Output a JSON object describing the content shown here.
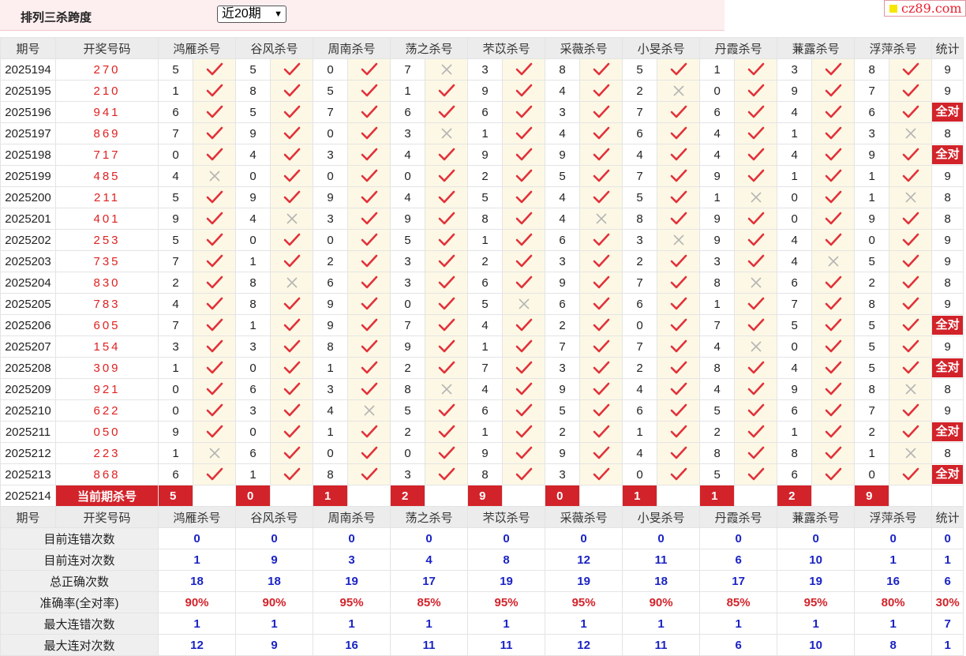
{
  "header": {
    "title": "排列三杀跨度",
    "range_select": "近20期",
    "site_logo": "cz89.com"
  },
  "colors": {
    "accent_red": "#d2232a",
    "draw_red": "#e02020",
    "stat_blue": "#1a23c4",
    "mark_bg": "#fcf8e5"
  },
  "columns": {
    "period": "期号",
    "draw": "开奖号码",
    "count": "统计",
    "experts": [
      "鸿雁杀号",
      "谷风杀号",
      "周南杀号",
      "荡之杀号",
      "芣苡杀号",
      "采薇杀号",
      "小旻杀号",
      "丹霞杀号",
      "蒹露杀号",
      "浮萍杀号"
    ]
  },
  "labels": {
    "all_correct": "全对",
    "current_kill": "当前期杀号"
  },
  "rows": [
    {
      "period": "2025194",
      "draw": "270",
      "k": [
        5,
        5,
        0,
        7,
        3,
        8,
        5,
        1,
        3,
        8
      ],
      "ok": [
        1,
        1,
        1,
        0,
        1,
        1,
        1,
        1,
        1,
        1
      ],
      "count": "9"
    },
    {
      "period": "2025195",
      "draw": "210",
      "k": [
        1,
        8,
        5,
        1,
        9,
        4,
        2,
        0,
        9,
        7
      ],
      "ok": [
        1,
        1,
        1,
        1,
        1,
        1,
        0,
        1,
        1,
        1
      ],
      "count": "9"
    },
    {
      "period": "2025196",
      "draw": "941",
      "k": [
        6,
        5,
        7,
        6,
        6,
        3,
        7,
        6,
        4,
        6
      ],
      "ok": [
        1,
        1,
        1,
        1,
        1,
        1,
        1,
        1,
        1,
        1
      ],
      "count": "全对"
    },
    {
      "period": "2025197",
      "draw": "869",
      "k": [
        7,
        9,
        0,
        3,
        1,
        4,
        6,
        4,
        1,
        3
      ],
      "ok": [
        1,
        1,
        1,
        0,
        1,
        1,
        1,
        1,
        1,
        0
      ],
      "count": "8"
    },
    {
      "period": "2025198",
      "draw": "717",
      "k": [
        0,
        4,
        3,
        4,
        9,
        9,
        4,
        4,
        4,
        9
      ],
      "ok": [
        1,
        1,
        1,
        1,
        1,
        1,
        1,
        1,
        1,
        1
      ],
      "count": "全对"
    },
    {
      "period": "2025199",
      "draw": "485",
      "k": [
        4,
        0,
        0,
        0,
        2,
        5,
        7,
        9,
        1,
        1
      ],
      "ok": [
        0,
        1,
        1,
        1,
        1,
        1,
        1,
        1,
        1,
        1
      ],
      "count": "9"
    },
    {
      "period": "2025200",
      "draw": "211",
      "k": [
        5,
        9,
        9,
        4,
        5,
        4,
        5,
        1,
        0,
        1
      ],
      "ok": [
        1,
        1,
        1,
        1,
        1,
        1,
        1,
        0,
        1,
        0
      ],
      "count": "8"
    },
    {
      "period": "2025201",
      "draw": "401",
      "k": [
        9,
        4,
        3,
        9,
        8,
        4,
        8,
        9,
        0,
        9
      ],
      "ok": [
        1,
        0,
        1,
        1,
        1,
        0,
        1,
        1,
        1,
        1
      ],
      "count": "8"
    },
    {
      "period": "2025202",
      "draw": "253",
      "k": [
        5,
        0,
        0,
        5,
        1,
        6,
        3,
        9,
        4,
        0
      ],
      "ok": [
        1,
        1,
        1,
        1,
        1,
        1,
        0,
        1,
        1,
        1
      ],
      "count": "9"
    },
    {
      "period": "2025203",
      "draw": "735",
      "k": [
        7,
        1,
        2,
        3,
        2,
        3,
        2,
        3,
        4,
        5
      ],
      "ok": [
        1,
        1,
        1,
        1,
        1,
        1,
        1,
        1,
        0,
        1
      ],
      "count": "9"
    },
    {
      "period": "2025204",
      "draw": "830",
      "k": [
        2,
        8,
        6,
        3,
        6,
        9,
        7,
        8,
        6,
        2
      ],
      "ok": [
        1,
        0,
        1,
        1,
        1,
        1,
        1,
        0,
        1,
        1
      ],
      "count": "8"
    },
    {
      "period": "2025205",
      "draw": "783",
      "k": [
        4,
        8,
        9,
        0,
        5,
        6,
        6,
        1,
        7,
        8
      ],
      "ok": [
        1,
        1,
        1,
        1,
        0,
        1,
        1,
        1,
        1,
        1
      ],
      "count": "9"
    },
    {
      "period": "2025206",
      "draw": "605",
      "k": [
        7,
        1,
        9,
        7,
        4,
        2,
        0,
        7,
        5,
        5
      ],
      "ok": [
        1,
        1,
        1,
        1,
        1,
        1,
        1,
        1,
        1,
        1
      ],
      "count": "全对"
    },
    {
      "period": "2025207",
      "draw": "154",
      "k": [
        3,
        3,
        8,
        9,
        1,
        7,
        7,
        4,
        0,
        5
      ],
      "ok": [
        1,
        1,
        1,
        1,
        1,
        1,
        1,
        0,
        1,
        1
      ],
      "count": "9"
    },
    {
      "period": "2025208",
      "draw": "309",
      "k": [
        1,
        0,
        1,
        2,
        7,
        3,
        2,
        8,
        4,
        5
      ],
      "ok": [
        1,
        1,
        1,
        1,
        1,
        1,
        1,
        1,
        1,
        1
      ],
      "count": "全对"
    },
    {
      "period": "2025209",
      "draw": "921",
      "k": [
        0,
        6,
        3,
        8,
        4,
        9,
        4,
        4,
        9,
        8
      ],
      "ok": [
        1,
        1,
        1,
        0,
        1,
        1,
        1,
        1,
        1,
        0
      ],
      "count": "8"
    },
    {
      "period": "2025210",
      "draw": "622",
      "k": [
        0,
        3,
        4,
        5,
        6,
        5,
        6,
        5,
        6,
        7
      ],
      "ok": [
        1,
        1,
        0,
        1,
        1,
        1,
        1,
        1,
        1,
        1
      ],
      "count": "9"
    },
    {
      "period": "2025211",
      "draw": "050",
      "k": [
        9,
        0,
        1,
        2,
        1,
        2,
        1,
        2,
        1,
        2
      ],
      "ok": [
        1,
        1,
        1,
        1,
        1,
        1,
        1,
        1,
        1,
        1
      ],
      "count": "全对"
    },
    {
      "period": "2025212",
      "draw": "223",
      "k": [
        1,
        6,
        0,
        0,
        9,
        9,
        4,
        8,
        8,
        1
      ],
      "ok": [
        0,
        1,
        1,
        1,
        1,
        1,
        1,
        1,
        1,
        0
      ],
      "count": "8"
    },
    {
      "period": "2025213",
      "draw": "868",
      "k": [
        6,
        1,
        8,
        3,
        8,
        3,
        0,
        5,
        6,
        0
      ],
      "ok": [
        1,
        1,
        1,
        1,
        1,
        1,
        1,
        1,
        1,
        1
      ],
      "count": "全对"
    }
  ],
  "current": {
    "period": "2025214",
    "kills": [
      "5",
      "0",
      "1",
      "2",
      "9",
      "0",
      "1",
      "1",
      "2",
      "9"
    ]
  },
  "stats": [
    {
      "label": "目前连错次数",
      "values": [
        "0",
        "0",
        "0",
        "0",
        "0",
        "0",
        "0",
        "0",
        "0",
        "0"
      ],
      "total": "0"
    },
    {
      "label": "目前连对次数",
      "values": [
        "1",
        "9",
        "3",
        "4",
        "8",
        "12",
        "11",
        "6",
        "10",
        "1"
      ],
      "total": "1"
    },
    {
      "label": "总正确次数",
      "values": [
        "18",
        "18",
        "19",
        "17",
        "19",
        "19",
        "18",
        "17",
        "19",
        "16"
      ],
      "total": "6"
    },
    {
      "label": "准确率(全对率)",
      "values": [
        "90%",
        "90%",
        "95%",
        "85%",
        "95%",
        "95%",
        "90%",
        "85%",
        "95%",
        "80%"
      ],
      "total": "30%",
      "is_rate": true
    },
    {
      "label": "最大连错次数",
      "values": [
        "1",
        "1",
        "1",
        "1",
        "1",
        "1",
        "1",
        "1",
        "1",
        "1"
      ],
      "total": "7"
    },
    {
      "label": "最大连对次数",
      "values": [
        "12",
        "9",
        "16",
        "11",
        "11",
        "12",
        "11",
        "6",
        "10",
        "8"
      ],
      "total": "1"
    }
  ]
}
